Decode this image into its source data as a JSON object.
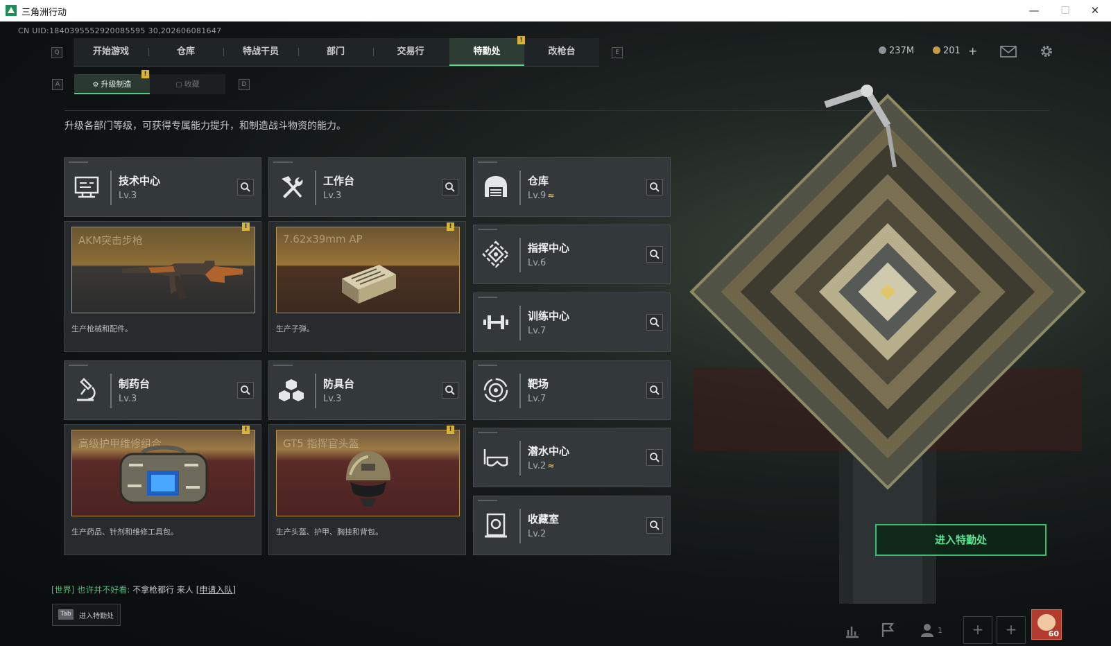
{
  "window": {
    "title": "三角洲行动",
    "minimize": "—",
    "maximize": "☐",
    "close": "✕"
  },
  "uid": "CN UID:1840395552920085595 30,202606081647",
  "nav": {
    "key_left": "Q",
    "key_right": "E",
    "tabs": [
      "开始游戏",
      "仓库",
      "特战干员",
      "部门",
      "交易行",
      "特勤处",
      "改枪台"
    ],
    "active_tab": "特勤处",
    "badge": "!"
  },
  "resources": {
    "currency1": "237M",
    "currency2": "201",
    "add": "+"
  },
  "subnav": {
    "key_left": "A",
    "key_right": "D",
    "tabs": [
      "升级制造",
      "收藏"
    ],
    "active": "升级制造",
    "badge": "!"
  },
  "description": "升级各部门等级，可获得专属能力提升，和制造战斗物资的能力。",
  "departments": {
    "tech_center": {
      "name": "技术中心",
      "level": "Lv.3"
    },
    "workbench": {
      "name": "工作台",
      "level": "Lv.3"
    },
    "warehouse": {
      "name": "仓库",
      "level": "Lv.9",
      "upgrade": "≈"
    },
    "command_center": {
      "name": "指挥中心",
      "level": "Lv.6"
    },
    "training_center": {
      "name": "训练中心",
      "level": "Lv.7"
    },
    "pharmacy": {
      "name": "制药台",
      "level": "Lv.3"
    },
    "armor_bench": {
      "name": "防具台",
      "level": "Lv.3"
    },
    "shooting_range": {
      "name": "靶场",
      "level": "Lv.7"
    },
    "diving_center": {
      "name": "潜水中心",
      "level": "Lv.2",
      "upgrade": "≈"
    },
    "collection_room": {
      "name": "收藏室",
      "level": "Lv.2"
    }
  },
  "production": {
    "tech": {
      "item": "AKM突击步枪",
      "desc": "生产枪械和配件。",
      "badge": "!"
    },
    "workbench": {
      "item": "7.62x39mm AP",
      "desc": "生产子弹。",
      "badge": "!"
    },
    "pharmacy": {
      "item": "高级护甲维修组合",
      "desc": "生产药品、针剂和维修工具包。",
      "badge": "!"
    },
    "armor": {
      "item": "GT5 指挥官头盔",
      "desc": "生产头盔、护甲、胸挂和背包。",
      "badge": "!"
    }
  },
  "enter_button": "进入特勤处",
  "chat": {
    "channel": "[世界]",
    "user": "也许并不好看:",
    "message": "不拿枪都行 来人",
    "link": "[申请入队]"
  },
  "tab_hint": {
    "key": "Tab",
    "label": "进入特勤处"
  },
  "bottom": {
    "team_count": "1",
    "plus": "+",
    "level": "60"
  },
  "colors": {
    "accent_green": "#5ad28a",
    "badge_yellow": "#d6b43a",
    "gold_border": "#b8944c"
  }
}
